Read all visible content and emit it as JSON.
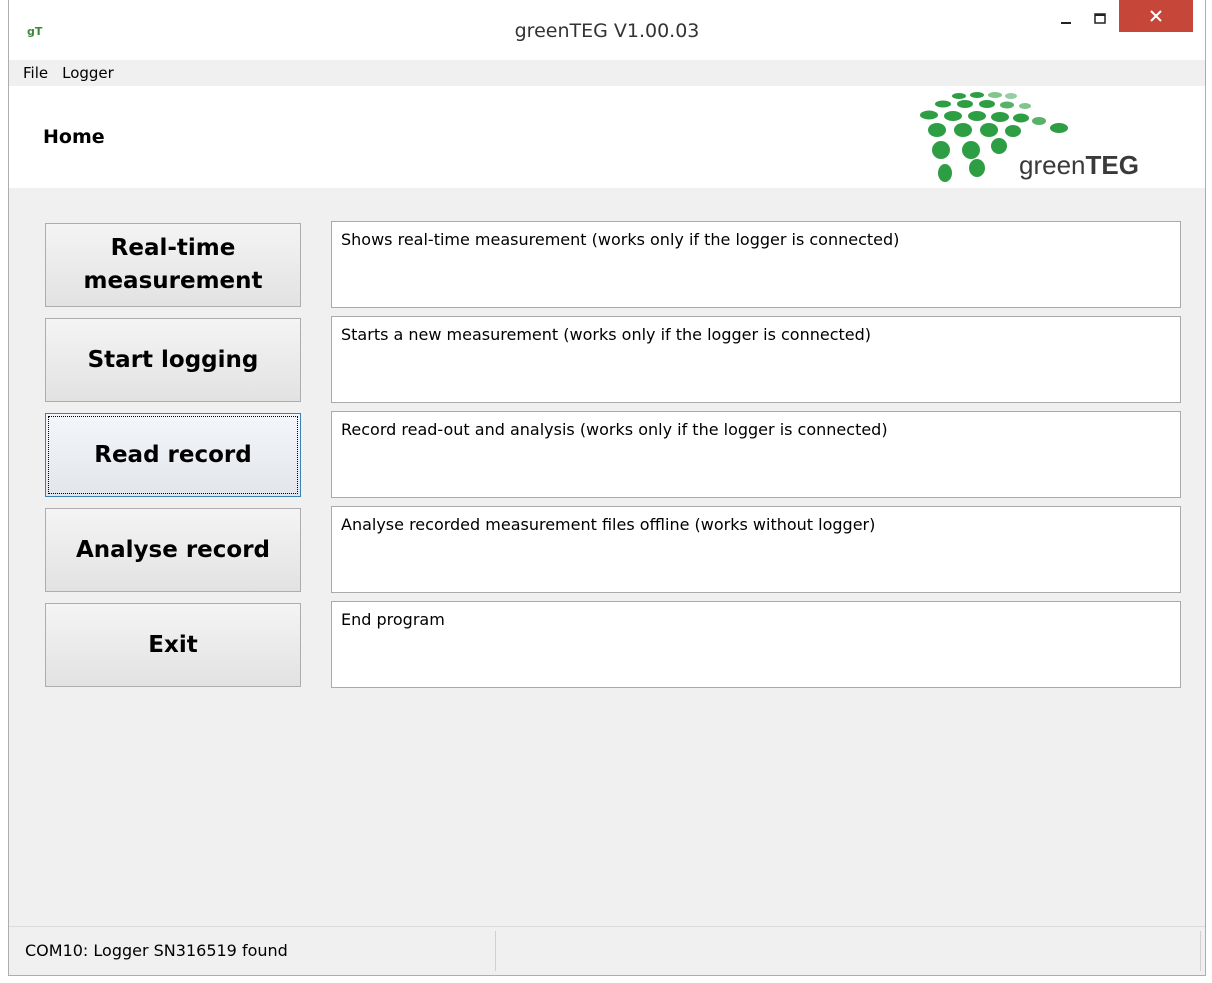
{
  "window": {
    "title": "greenTEG V1.00.03",
    "icon": "gT",
    "controls": {
      "minimize": "–",
      "maximize": "☐",
      "close": "✕"
    }
  },
  "menu": {
    "items": [
      "File",
      "Logger"
    ]
  },
  "header": {
    "title": "Home",
    "logo": {
      "text_light": "green",
      "text_bold": "TEG",
      "color": "#2e9e44"
    }
  },
  "actions": [
    {
      "label": "Real-time measurement",
      "description": "Shows real-time measurement (works only if the logger is connected)"
    },
    {
      "label": "Start logging",
      "description": "Starts a new measurement (works only if the logger is connected)"
    },
    {
      "label": "Read record",
      "description": "Record read-out and analysis (works only if the logger is connected)"
    },
    {
      "label": "Analyse record",
      "description": "Analyse recorded measurement files offline (works without logger)"
    },
    {
      "label": "Exit",
      "description": "End program"
    }
  ],
  "status": {
    "text": "COM10: Logger SN316519 found"
  },
  "colors": {
    "close_button": "#c7463a",
    "focus_border": "#3c7fb1",
    "logo_green": "#2e9e44"
  }
}
